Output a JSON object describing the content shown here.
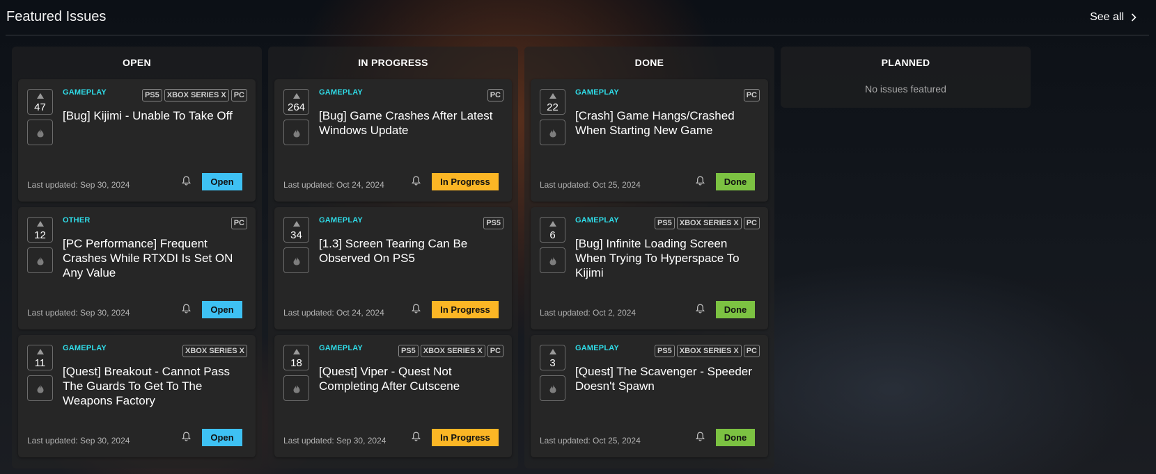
{
  "header": {
    "title": "Featured Issues",
    "see_all": "See all"
  },
  "columns": [
    {
      "title": "OPEN",
      "cards": [
        {
          "votes": "47",
          "category": "GAMEPLAY",
          "platforms": [
            "PS5",
            "XBOX SERIES X",
            "PC"
          ],
          "title": "[Bug] Kijimi - Unable To Take Off",
          "updated": "Last updated: Sep 30, 2024",
          "status": "Open"
        },
        {
          "votes": "12",
          "category": "OTHER",
          "platforms": [
            "PC"
          ],
          "title": "[PC Performance] Frequent Crashes While RTXDI Is Set ON Any Value",
          "updated": "Last updated: Sep 30, 2024",
          "status": "Open"
        },
        {
          "votes": "11",
          "category": "GAMEPLAY",
          "platforms": [
            "XBOX SERIES X"
          ],
          "title": "[Quest] Breakout - Cannot Pass The Guards To Get To The Weapons Factory",
          "updated": "Last updated: Sep 30, 2024",
          "status": "Open"
        }
      ]
    },
    {
      "title": "IN PROGRESS",
      "cards": [
        {
          "votes": "264",
          "category": "GAMEPLAY",
          "platforms": [
            "PC"
          ],
          "title": "[Bug] Game Crashes After Latest Windows Update",
          "updated": "Last updated: Oct 24, 2024",
          "status": "In Progress"
        },
        {
          "votes": "34",
          "category": "GAMEPLAY",
          "platforms": [
            "PS5"
          ],
          "title": "[1.3] Screen Tearing Can Be Observed On PS5",
          "updated": "Last updated: Oct 24, 2024",
          "status": "In Progress"
        },
        {
          "votes": "18",
          "category": "GAMEPLAY",
          "platforms": [
            "PS5",
            "XBOX SERIES X",
            "PC"
          ],
          "title": "[Quest] Viper - Quest Not Completing After Cutscene",
          "updated": "Last updated: Sep 30, 2024",
          "status": "In Progress"
        }
      ]
    },
    {
      "title": "DONE",
      "cards": [
        {
          "votes": "22",
          "category": "GAMEPLAY",
          "platforms": [
            "PC"
          ],
          "title": "[Crash] Game Hangs/Crashed When Starting New Game",
          "updated": "Last updated: Oct 25, 2024",
          "status": "Done"
        },
        {
          "votes": "6",
          "category": "GAMEPLAY",
          "platforms": [
            "PS5",
            "XBOX SERIES X",
            "PC"
          ],
          "title": "[Bug] Infinite Loading Screen When Trying To Hyperspace To Kijimi",
          "updated": "Last updated: Oct 2, 2024",
          "status": "Done"
        },
        {
          "votes": "3",
          "category": "GAMEPLAY",
          "platforms": [
            "PS5",
            "XBOX SERIES X",
            "PC"
          ],
          "title": "[Quest] The Scavenger - Speeder Doesn't Spawn",
          "updated": "Last updated: Oct 25, 2024",
          "status": "Done"
        }
      ]
    },
    {
      "title": "PLANNED",
      "empty_text": "No issues featured"
    }
  ],
  "colors": {
    "accent_category": "#2fdce8",
    "status_open": "#3ec1f3",
    "status_in_progress": "#fbb625",
    "status_done": "#7cc242"
  },
  "icons": {
    "vote": "up-arrow-icon",
    "flame": "flame-icon",
    "notify": "bell-icon",
    "see_all": "chevron-right-icon"
  }
}
